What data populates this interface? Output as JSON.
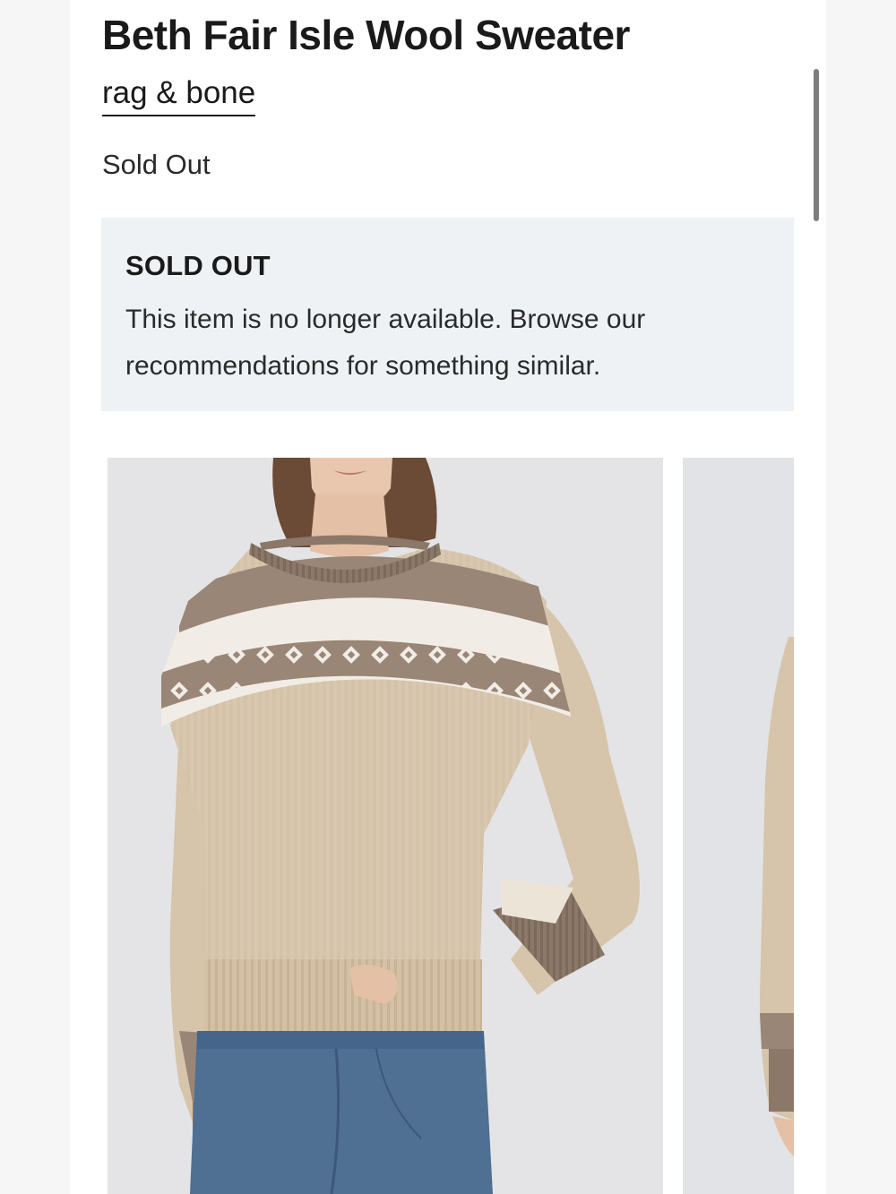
{
  "product": {
    "title": "Beth Fair Isle Wool Sweater",
    "brand": "rag & bone",
    "status": "Sold Out"
  },
  "notice": {
    "heading": "SOLD OUT",
    "body": "This item is no longer available. Browse our recommendations for something similar."
  },
  "gallery": {
    "images": [
      {
        "alt": "Model wearing Beth Fair Isle Wool Sweater, front view"
      },
      {
        "alt": "Beth Fair Isle Wool Sweater, alternate view"
      }
    ]
  },
  "colors": {
    "background": "#f6f6f6",
    "notice_background": "#eef2f5",
    "sweater_oatmeal": "#d9c8b0",
    "sweater_brown": "#8e7b6c",
    "jeans_blue": "#4f6f93"
  }
}
